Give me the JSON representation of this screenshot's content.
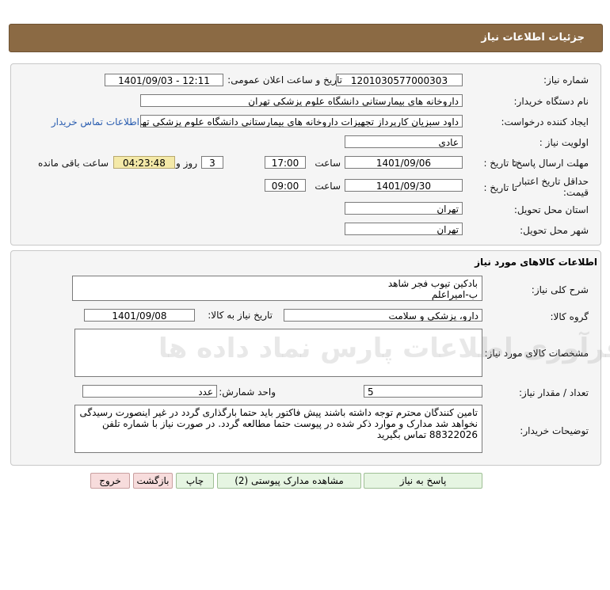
{
  "header": {
    "title": "جزئیات اطلاعات نیاز"
  },
  "info": {
    "need_number_label": "شماره نیاز:",
    "need_number": "1201030577000303",
    "announce_label": "تاریخ و ساعت اعلان عمومی:",
    "announce_value": "1401/09/03 - 12:11",
    "buyer_org_label": "نام دستگاه خریدار:",
    "buyer_org": "داروخانه های بیمارستانی دانشگاه علوم پزشکی تهران",
    "creator_label": "ایجاد کننده درخواست:",
    "creator": "داود سبزیان کارپرداز تجهیزات داروخانه های بیمارستانی دانشگاه علوم پزشکی تهران",
    "contact_link": "اطلاعات تماس خریدار",
    "priority_label": "اولویت نیاز :",
    "priority": "عادی",
    "deadline_label": "مهلت ارسال پاسخ:",
    "to_date_label": "تا تاریخ :",
    "deadline_date": "1401/09/06",
    "time_label": "ساعت",
    "deadline_time": "17:00",
    "days_value": "3",
    "days_label": "روز و",
    "remaining_value": "04:23:48",
    "remaining_label": "ساعت باقی مانده",
    "validity_label": "حداقل تاریخ اعتبار قیمت:",
    "validity_to_label": "تا تاریخ :",
    "validity_date": "1401/09/30",
    "validity_time_label": "ساعت",
    "validity_time": "09:00",
    "province_label": "استان محل تحویل:",
    "province": "تهران",
    "city_label": "شهر محل تحویل:",
    "city": "تهران"
  },
  "goods": {
    "section_title": "اطلاعات کالاهای مورد نیاز",
    "desc_label": "شرح کلی نیاز:",
    "desc_line1": "بادکین تیوب فجر شاهد",
    "desc_line2": "ب-امیراعلم",
    "group_label": "گروه کالا:",
    "group": "دارو، پزشکی و سلامت",
    "need_date_label": "تاریخ نیاز به کالا:",
    "need_date": "1401/09/08",
    "specs_label": "مشخصات کالای مورد نیاز:",
    "specs": "",
    "qty_label": "تعداد / مقدار نیاز:",
    "qty": "5",
    "unit_label": "واحد شمارش:",
    "unit": "عدد",
    "buyer_notes_label": "توضیحات خریدار:",
    "buyer_notes": "تامین کنندگان محترم توجه داشته باشند پیش فاکتور باید حتما بارگذاری گردد در غیر اینصورت رسیدگی نخواهد شد مدارک و موارد ذکر شده در پیوست حتما مطالعه گردد. در صورت نیاز با شماره تلفن 88322026 تماس بگیرید"
  },
  "buttons": {
    "reply": "پاسخ به نیاز",
    "attachments": "مشاهده مدارک پیوستی (2)",
    "print": "چاپ",
    "back": "بازگشت",
    "exit": "خروج"
  },
  "watermark": {
    "text": "مرکز فرآوری اطلاعات پارس نماد داده ها"
  },
  "colors": {
    "header_bg": "#8b6a44",
    "remaining_bg": "#f4e9a8",
    "link": "#2a5db0"
  }
}
